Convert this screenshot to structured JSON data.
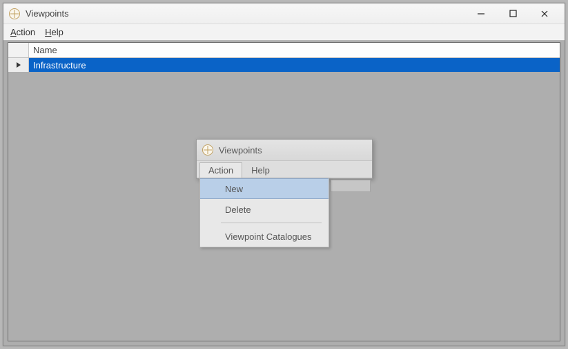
{
  "window": {
    "title": "Viewpoints",
    "menubar": {
      "action": "Action",
      "help": "Help"
    },
    "grid": {
      "header": "Name",
      "rows": [
        {
          "name": "Infrastructure",
          "selected": true
        }
      ]
    }
  },
  "popup": {
    "title": "Viewpoints",
    "menubar": {
      "action": "Action",
      "help": "Help"
    },
    "dropdown": {
      "items": [
        {
          "label": "New",
          "highlighted": true
        },
        {
          "label": "Delete"
        }
      ],
      "after_separator": [
        {
          "label": "Viewpoint Catalogues"
        }
      ]
    }
  }
}
